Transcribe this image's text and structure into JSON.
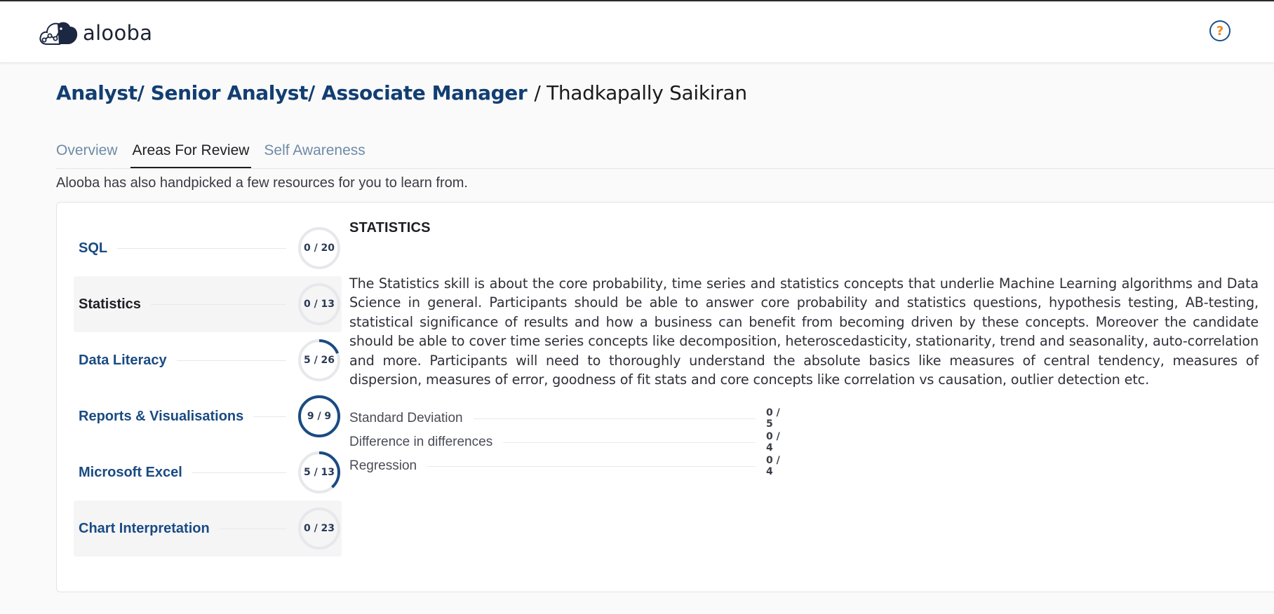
{
  "app": {
    "logo_text": "alooba",
    "help_label": "?"
  },
  "header": {
    "job_title": "Analyst/ Senior Analyst/ Associate Manager",
    "separator": "/",
    "candidate_name": "Thadkapally Saikiran"
  },
  "tabs": [
    {
      "label": "Overview",
      "active": false
    },
    {
      "label": "Areas For Review",
      "active": true
    },
    {
      "label": "Self Awareness",
      "active": false
    }
  ],
  "intro_text": "Alooba has also handpicked a few resources for you to learn from.",
  "skills": [
    {
      "name": "SQL",
      "score": "0 / 20",
      "fraction": 0.0,
      "selected": false
    },
    {
      "name": "Statistics",
      "score": "0 / 13",
      "fraction": 0.0,
      "selected": true
    },
    {
      "name": "Data Literacy",
      "score": "5 / 26",
      "fraction": 0.192,
      "selected": false
    },
    {
      "name": "Reports & Visualisations",
      "score": "9 / 9",
      "fraction": 1.0,
      "selected": false
    },
    {
      "name": "Microsoft Excel",
      "score": "5 / 13",
      "fraction": 0.385,
      "selected": false
    },
    {
      "name": "Chart Interpretation",
      "score": "0 / 23",
      "fraction": 0.0,
      "selected": false
    }
  ],
  "detail": {
    "title": "STATISTICS",
    "description": "The Statistics skill is about the core probability, time series and statistics concepts that underlie Machine Learning algorithms and Data Science in general. Participants should be able to answer core probability and statistics questions, hypothesis testing, AB-testing, statistical significance of results and how a business can benefit from becoming driven by these concepts. Moreover the candidate should be able to cover time series concepts like decomposition, heteroscedasticity, stationarity, trend and seasonality, auto-correlation and more. Participants will need to thoroughly understand the absolute basics like measures of central tendency, measures of dispersion, measures of error, goodness of fit stats and core concepts like correlation vs causation, outlier detection etc.",
    "subskills": [
      {
        "name": "Standard Deviation",
        "score": "0 / 5"
      },
      {
        "name": "Difference in differences",
        "score": "0 / 4"
      },
      {
        "name": "Regression",
        "score": "0 / 4"
      }
    ]
  },
  "colors": {
    "brand_navy": "#123e72",
    "ring_track": "#e6e8eb",
    "ring_progress": "#1a4b82",
    "help_accent": "#f08a24"
  }
}
